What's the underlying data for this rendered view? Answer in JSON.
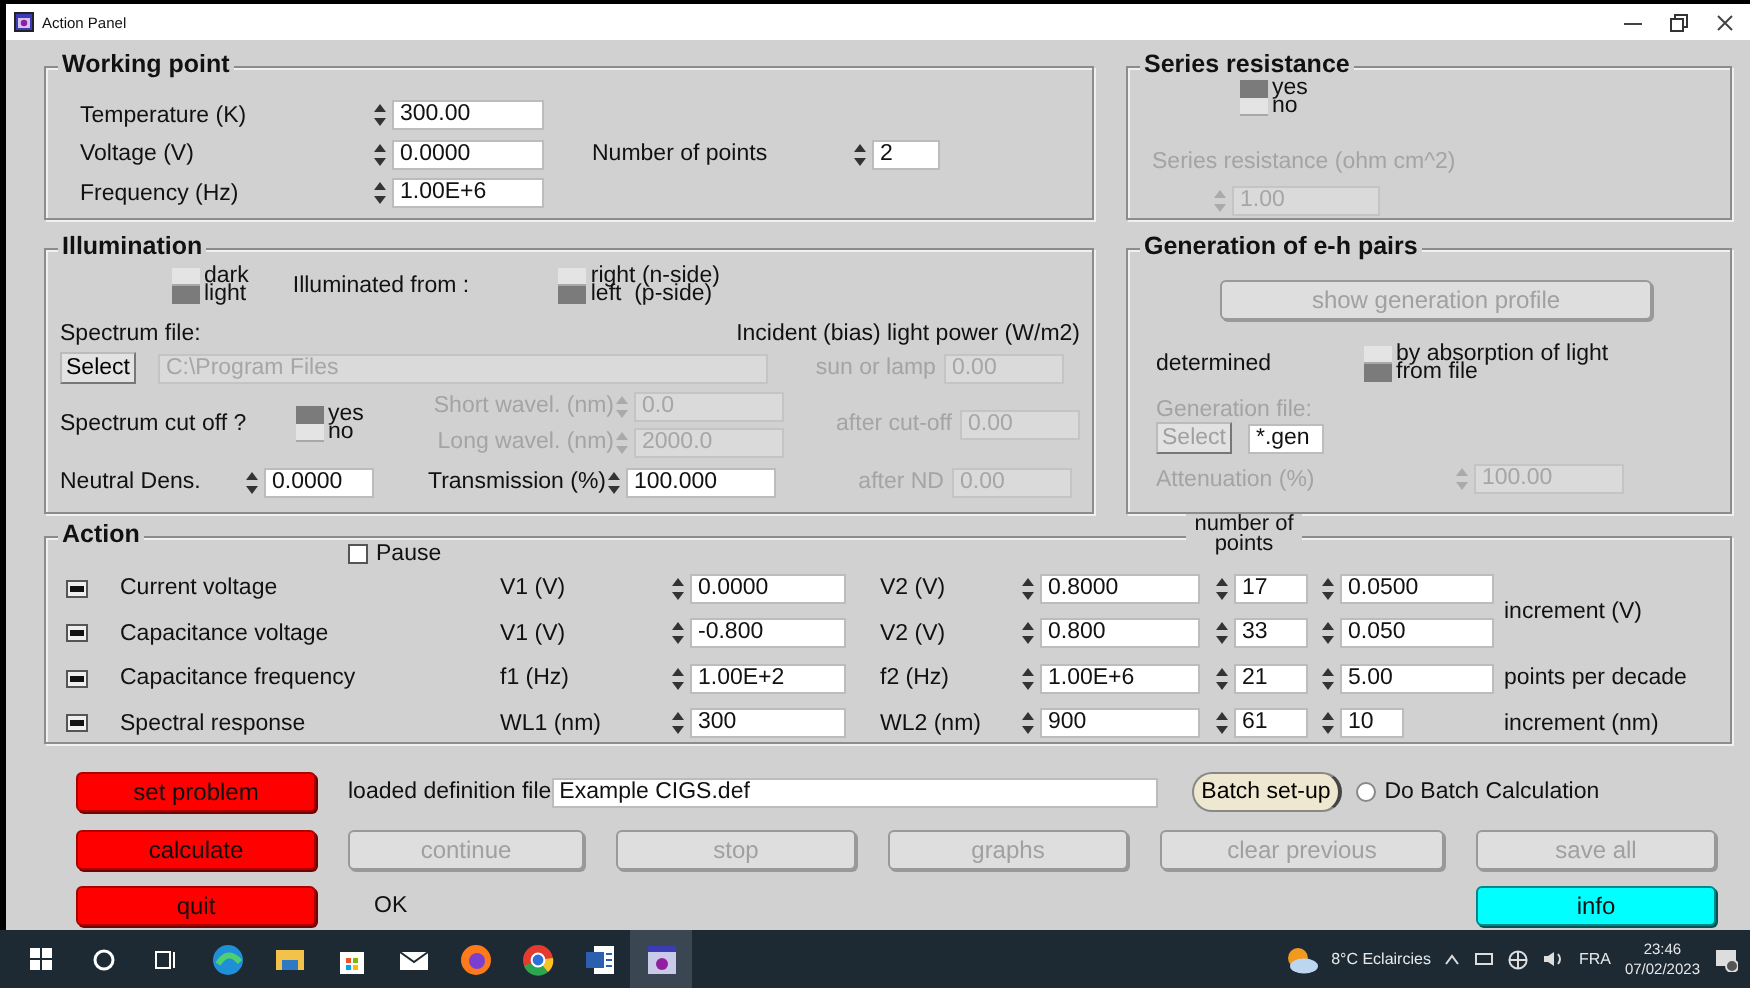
{
  "window": {
    "title": "Action Panel"
  },
  "working_point": {
    "title": "Working point",
    "fields": [
      {
        "label": "Temperature (K)",
        "value": "300.00"
      },
      {
        "label": "Voltage (V)",
        "value": "0.0000"
      },
      {
        "label": "Frequency (Hz)",
        "value": "1.00E+6"
      }
    ],
    "number_of_points": {
      "label": "Number of points",
      "value": "2"
    }
  },
  "series_resistance": {
    "title": "Series resistance",
    "options": [
      {
        "label": "yes",
        "selected": true
      },
      {
        "label": "no",
        "selected": false
      }
    ],
    "resistance": {
      "label": "Series resistance (ohm cm^2)",
      "value": "1.00",
      "disabled": true
    }
  },
  "illumination": {
    "title": "Illumination",
    "mode_options": [
      {
        "label": "dark",
        "selected": false
      },
      {
        "label": "light",
        "selected": true
      }
    ],
    "from_label": "Illuminated from :",
    "from_options": [
      {
        "label": "right (n-side)",
        "selected": false
      },
      {
        "label": "left  (p-side)",
        "selected": true
      }
    ],
    "spectrum_file_label": "Spectrum file:",
    "power_label": "Incident (bias) light power (W/m2)",
    "select_button": {
      "label": "Select",
      "disabled": false
    },
    "spectrum_file": {
      "value": "C:\\Program Files",
      "disabled": true
    },
    "sun_or_lamp": {
      "label": "sun or lamp",
      "value": "0.00",
      "disabled": true
    },
    "cut_off_label": "Spectrum cut off ?",
    "cut_off_options": [
      {
        "label": "yes",
        "selected": true
      },
      {
        "label": "no",
        "selected": false
      }
    ],
    "short_wavelength": {
      "label": "Short wavel. (nm)",
      "value": "0.0",
      "disabled": true
    },
    "long_wavelength": {
      "label": "Long wavel. (nm)",
      "value": "2000.0",
      "disabled": true
    },
    "after_cut_off": {
      "label": "after cut-off",
      "value": "0.00",
      "disabled": true
    },
    "neutral_density": {
      "label": "Neutral Dens.",
      "value": "0.0000",
      "disabled": false
    },
    "transmission": {
      "label": "Transmission (%)",
      "value": "100.000",
      "disabled": false
    },
    "after_nd": {
      "label": "after ND",
      "value": "0.00",
      "disabled": true
    }
  },
  "generation": {
    "title": "Generation of e-h pairs",
    "profile_button": {
      "label": "show generation profile",
      "disabled": true
    },
    "determined_label": "determined",
    "options": [
      {
        "label": "by absorption of light",
        "selected": false
      },
      {
        "label": "from file",
        "selected": true
      }
    ],
    "file_label": {
      "text": "Generation file:",
      "disabled": true
    },
    "select_button": {
      "label": "Select",
      "disabled": true
    },
    "file_field": {
      "value": "*.gen",
      "disabled": false
    },
    "attenuation": {
      "label": "Attenuation  (%)",
      "value": "100.00",
      "disabled": true
    }
  },
  "action": {
    "title": "Action",
    "pause": {
      "label": "Pause",
      "checked": false
    },
    "points_header": "number of points",
    "rows": [
      {
        "name": "Current voltage",
        "from_label": "V1 (V)",
        "from": "0.0000",
        "to_label": "V2 (V)",
        "to": "0.8000",
        "points": "17",
        "step": "0.0500",
        "unit": "increment (V)"
      },
      {
        "name": "Capacitance voltage",
        "from_label": "V1 (V)",
        "from": "-0.800",
        "to_label": "V2 (V)",
        "to": "0.800",
        "points": "33",
        "step": "0.050"
      },
      {
        "name": "Capacitance frequency",
        "from_label": "f1 (Hz)",
        "from": "1.00E+2",
        "to_label": "f2 (Hz)",
        "to": "1.00E+6",
        "points": "21",
        "step": "5.00",
        "unit": "points per decade"
      },
      {
        "name": "Spectral response",
        "from_label": "WL1 (nm)",
        "from": "300",
        "to_label": "WL2 (nm)",
        "to": "900",
        "points": "61",
        "step": "10",
        "unit": "increment (nm)"
      }
    ]
  },
  "bottom": {
    "row_1": {
      "button": {
        "label": "set problem",
        "kind": "action",
        "disabled": false
      },
      "definition": {
        "label": "loaded definition file",
        "value": "Example CIGS.def"
      },
      "batch_button": {
        "label": "Batch set-up"
      },
      "batch_option": {
        "label": "Do Batch Calculation",
        "selected": false
      }
    },
    "row_2": [
      {
        "label": "calculate",
        "kind": "action",
        "disabled": false
      },
      {
        "label": "continue",
        "kind": "plain",
        "disabled": true
      },
      {
        "label": "stop",
        "kind": "plain",
        "disabled": true
      },
      {
        "label": "graphs",
        "kind": "plain",
        "disabled": true
      },
      {
        "label": "clear previous",
        "kind": "plain",
        "disabled": true
      },
      {
        "label": "save all",
        "kind": "plain",
        "disabled": true
      }
    ],
    "row_3": {
      "button": {
        "label": "quit",
        "kind": "action",
        "disabled": false
      },
      "status": "OK",
      "info_button": {
        "label": "info",
        "kind": "info",
        "disabled": false
      }
    }
  },
  "taskbar": {
    "weather": "8°C  Eclaircies",
    "language": "FRA",
    "time": "23:46",
    "date": "07/02/2023"
  }
}
